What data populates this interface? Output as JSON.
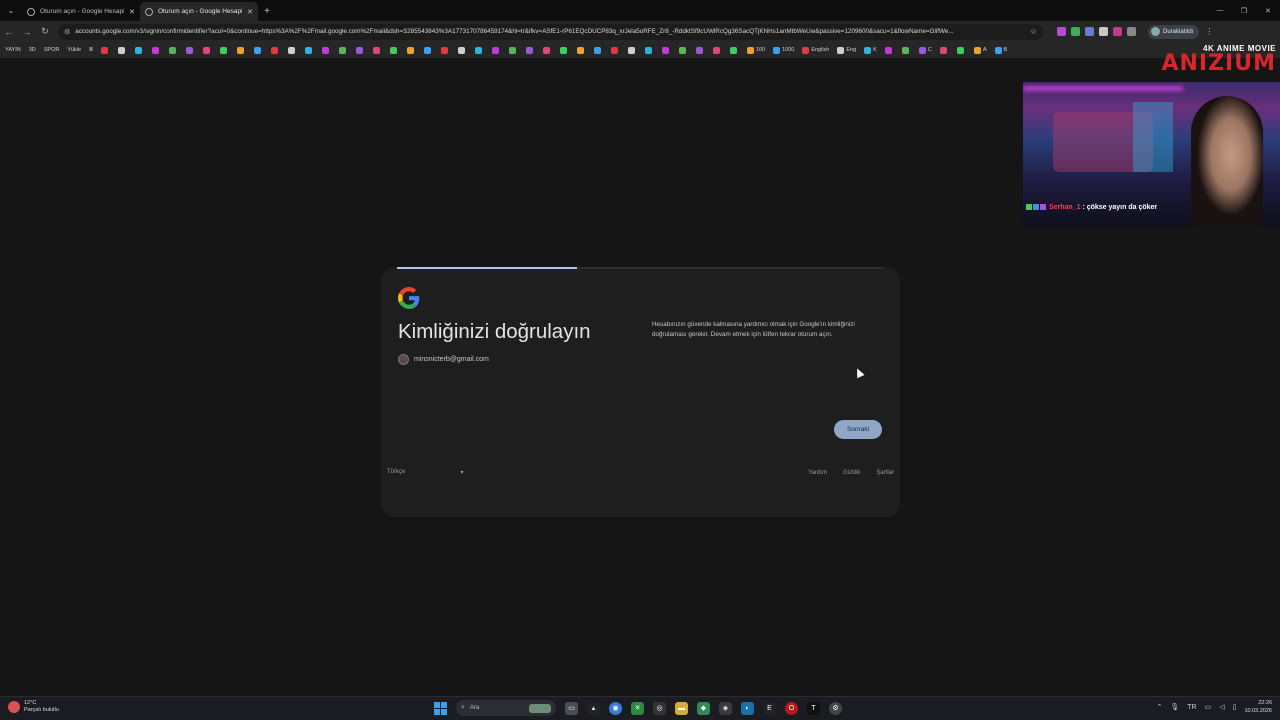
{
  "tabs": [
    {
      "title": "Oturum açın - Google Hesapları",
      "active": false
    },
    {
      "title": "Oturum açın - Google Hesapları",
      "active": true
    }
  ],
  "address_bar": {
    "url": "accounts.google.com/v3/signin/confirmidentifier?acuI=0&continue=https%3A%2F%2Fmail.google.com%2Fmail&dsh=S285543843%3A1773170786459174&hl=tr&ifkv=ASfE1-rP61EQcDUCP83q_xrJela5oRFE_Zr8_-RddktSf9cUWlRcQg36SacQTjKNHs1anMtbWeUw&passive=1209600&sacu=1&flowName=GlifWe..."
  },
  "profile": {
    "label": "Duraklatıldı"
  },
  "bookmarks": [
    "YAYIN",
    "3D",
    "SPOR",
    "Yükle",
    "Ⅲ",
    "",
    "",
    "",
    "",
    "",
    "",
    "",
    "",
    "",
    "",
    "",
    "",
    "",
    "",
    "",
    "",
    "",
    "",
    "",
    "",
    "",
    "",
    "",
    "",
    "",
    "",
    "",
    "",
    "",
    "",
    "",
    "",
    "",
    "",
    "",
    "",
    "",
    "",
    "100",
    "1000",
    "English",
    "Eng",
    "K",
    "",
    "",
    "C",
    "",
    "",
    "A",
    "B"
  ],
  "page": {
    "progress_fraction": 0.37,
    "title": "Kimliğinizi doğrulayın",
    "account_email": "minsnicterb@gmail.com",
    "description": "Hesabınızın güvende kalmasına yardımcı olmak için Google'ın kimliğinizi doğrulaması gerekir. Devam etmek için lütfen tekrar oturum açın.",
    "next_button": "Sonraki"
  },
  "footer": {
    "language": "Türkçe",
    "language_arrow": "▾",
    "links": [
      "Yardım",
      "Gizlilik",
      "Şartlar"
    ]
  },
  "overlay": {
    "logo_small": "4K ANIME MOVIE",
    "logo_big": "ANIZIUM",
    "chat_user": "Serhan_1",
    "chat_message": ": çökse yayın da çöker"
  },
  "taskbar": {
    "weather_temp": "12°C",
    "weather_desc": "Parçalı bulutlu",
    "search_placeholder": "Ara",
    "language_indicator": "TR",
    "time": "22:26",
    "date": "10.03.2026"
  },
  "colors": {
    "accent_blue": "#a8c7fa",
    "next_button_bg": "#8fa6c7",
    "logo_red": "#d8262b"
  }
}
